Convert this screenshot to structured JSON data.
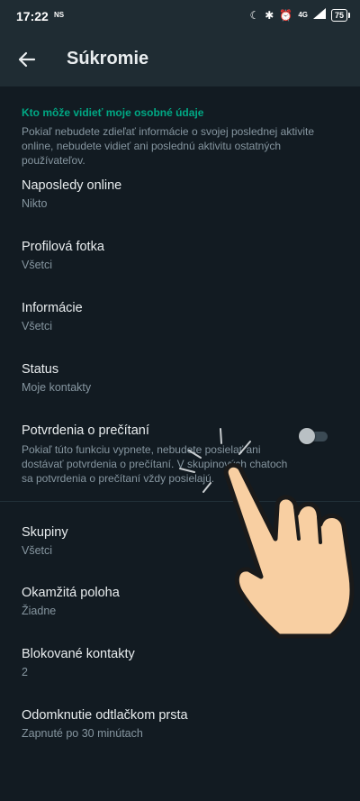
{
  "status_bar": {
    "time": "17:22",
    "carrier_tag": "NS",
    "network": "4G",
    "battery": "75"
  },
  "header": {
    "title": "Súkromie"
  },
  "section": {
    "title": "Kto môže vidieť moje osobné údaje",
    "description": "Pokiaľ nebudete zdieľať informácie o svojej poslednej aktivite online, nebudete vidieť ani poslednú aktivitu ostatných používateľov."
  },
  "items": [
    {
      "label": "Naposledy online",
      "value": "Nikto"
    },
    {
      "label": "Profilová fotka",
      "value": "Všetci"
    },
    {
      "label": "Informácie",
      "value": "Všetci"
    },
    {
      "label": "Status",
      "value": "Moje kontakty"
    }
  ],
  "read_receipts": {
    "label": "Potvrdenia o prečítaní",
    "description": "Pokiaľ túto funkciu vypnete, nebudete posielať ani dostávať potvrdenia o prečítaní. V skupinových chatoch sa potvrdenia o prečítaní vždy posielajú.",
    "enabled": false
  },
  "items2": [
    {
      "label": "Skupiny",
      "value": "Všetci"
    },
    {
      "label": "Okamžitá poloha",
      "value": "Žiadne"
    },
    {
      "label": "Blokované kontakty",
      "value": "2"
    },
    {
      "label": "Odomknutie odtlačkom prsta",
      "value": "Zapnuté po 30 minútach"
    }
  ],
  "colors": {
    "background": "#121b22",
    "appbar": "#1f2c33",
    "accent": "#00a884",
    "secondary_text": "#8696a0"
  }
}
